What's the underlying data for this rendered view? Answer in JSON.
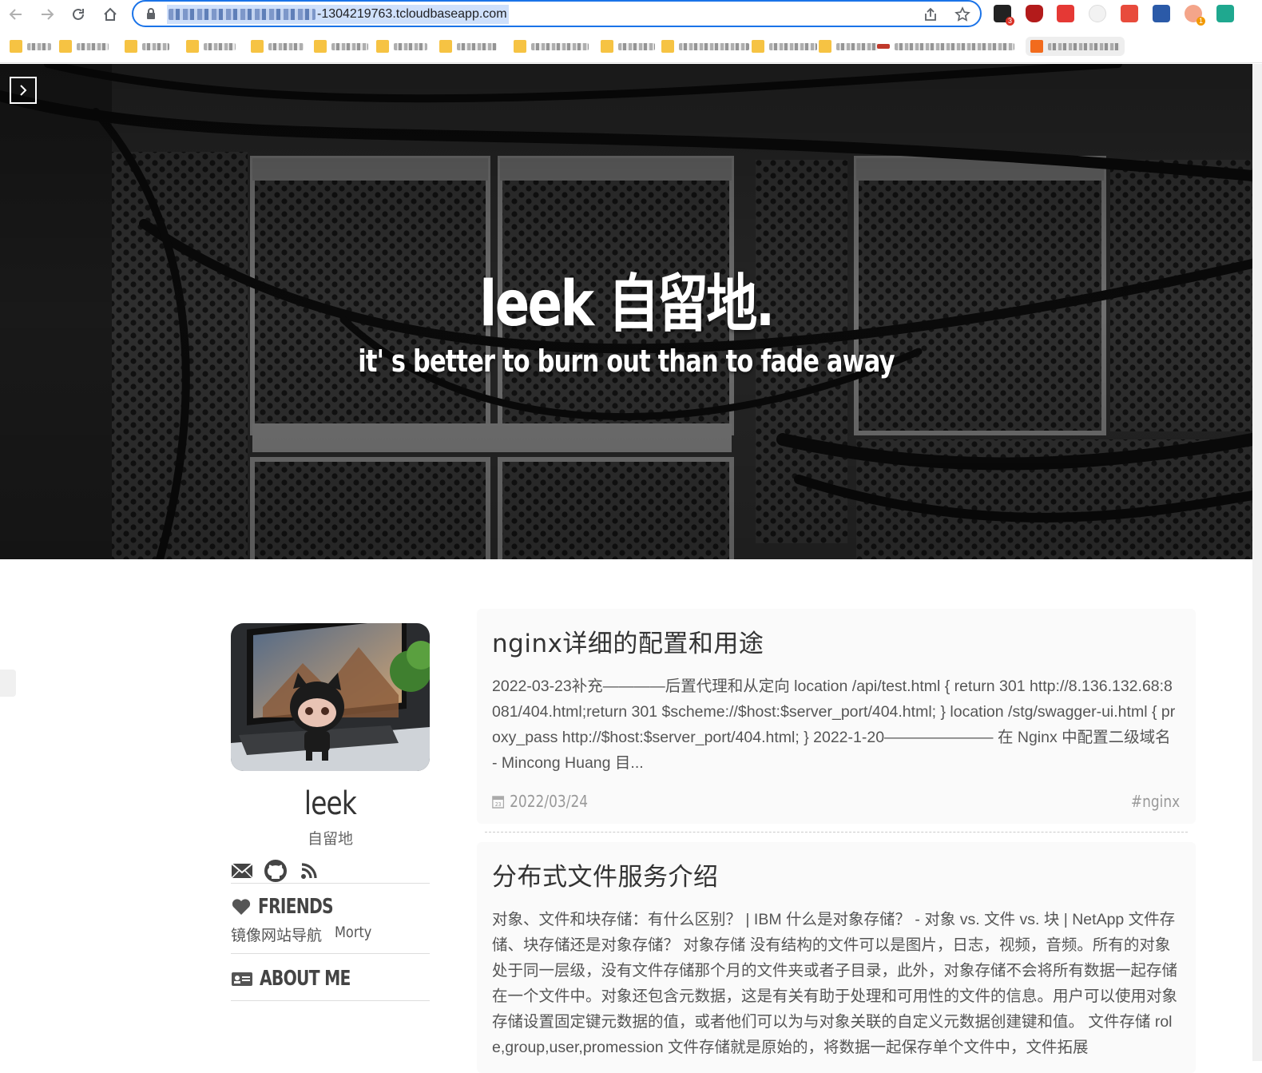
{
  "browser": {
    "url_visible": "-1304219763.tcloudbaseapp.com",
    "badges": {
      "ext1": "3",
      "ext10": "1"
    }
  },
  "hero": {
    "title": "leek 自留地.",
    "subtitle": "it' s better to burn out than to fade away"
  },
  "profile": {
    "name": "leek",
    "tagline": "自留地",
    "friends_title": "FRIENDS",
    "friends": [
      "镜像网站导航",
      "Morty"
    ],
    "about_title": "ABOUT ME"
  },
  "posts": [
    {
      "title": "nginx详细的配置和用途",
      "excerpt": "2022-03-23补充————后置代理和从定向 location /api/test.html { return 301 http://8.136.132.68:8081/404.html;return 301 $scheme://$host:$server_port/404.html; } location /stg/swagger-ui.html { proxy_pass http://$host:$server_port/404.html; } 2022-1-20——————— 在 Nginx 中配置二级域名 - Mincong Huang 目...",
      "date": "2022/03/24",
      "tag": "#nginx"
    },
    {
      "title": "分布式文件服务介绍",
      "excerpt": "对象、文件和块存储：有什么区别？ | IBM 什么是对象存储？ - 对象 vs. 文件 vs. 块 | NetApp 文件存储、块存储还是对象存储？ 对象存储 没有结构的文件可以是图片，日志，视频，音频。所有的对象处于同一层级，没有文件存储那个月的文件夹或者子目录，此外，对象存储不会将所有数据一起存储在一个文件中。对象还包含元数据，这是有关有助于处理和可用性的文件的信息。用户可以使用对象存储设置固定键元数据的值，或者他们可以为与对象关联的自定义元数据创建键和值。 文件存储 role,group,user,promession 文件存储就是原始的，将数据一起保存单个文件中，文件拓展"
    }
  ]
}
